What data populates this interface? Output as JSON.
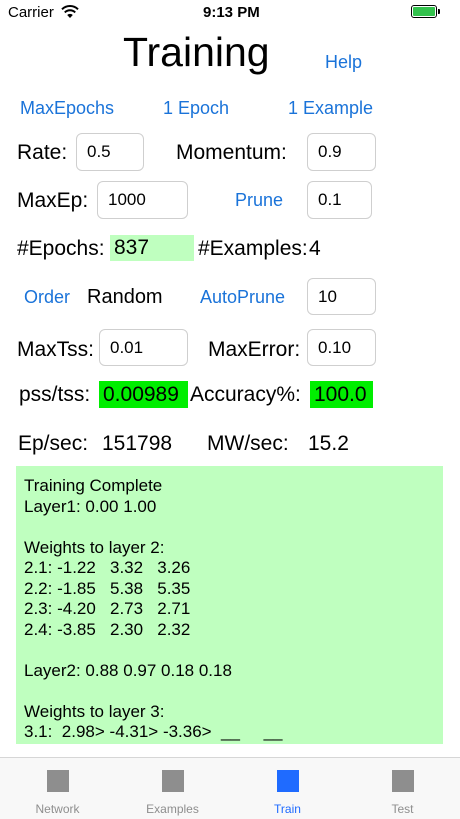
{
  "status_bar": {
    "carrier": "Carrier",
    "time": "9:13 PM"
  },
  "header": {
    "title": "Training",
    "help": "Help"
  },
  "modes": {
    "max_epochs": "MaxEpochs",
    "one_epoch": "1 Epoch",
    "one_example": "1 Example"
  },
  "rate": {
    "label": "Rate:",
    "value": "0.5"
  },
  "momentum": {
    "label": "Momentum:",
    "value": "0.9"
  },
  "max_ep": {
    "label": "MaxEp:",
    "value": "1000"
  },
  "prune": {
    "label": "Prune",
    "value": "0.1"
  },
  "epochs": {
    "label": "#Epochs:",
    "value": "837"
  },
  "examples": {
    "label": "#Examples:",
    "value": "4"
  },
  "order": {
    "label": "Order",
    "value": "Random"
  },
  "auto_prune": {
    "label": "AutoPrune",
    "value": "10"
  },
  "max_tss": {
    "label": "MaxTss:",
    "value": "0.01"
  },
  "max_error": {
    "label": "MaxError:",
    "value": "0.10"
  },
  "pss_tss": {
    "label": "pss/tss:",
    "value": "0.00989"
  },
  "accuracy": {
    "label": "Accuracy%:",
    "value": "100.0"
  },
  "ep_sec": {
    "label": "Ep/sec:",
    "value": "151798"
  },
  "mw_sec": {
    "label": "MW/sec:",
    "value": "15.2"
  },
  "output": {
    "lines": [
      "Training Complete",
      "Layer1: 0.00 1.00",
      "",
      "Weights to layer 2:",
      "2.1: -1.22   3.32   3.26",
      "2.2: -1.85   5.38   5.35",
      "2.3: -4.20   2.73   2.71",
      "2.4: -3.85   2.30   2.32",
      "",
      "Layer2: 0.88 0.97 0.18 0.18",
      "",
      "Weights to layer 3:",
      "3.1:  2.98> -4.31> -3.36>  __     __"
    ]
  },
  "tabs": [
    {
      "label": "Network"
    },
    {
      "label": "Examples"
    },
    {
      "label": "Train"
    },
    {
      "label": "Test"
    }
  ],
  "colors": {
    "accent": "#1a73d9",
    "highlight_light": "#bfffbf",
    "highlight_strong": "#00ee00",
    "tab_active": "#1f6bff"
  }
}
